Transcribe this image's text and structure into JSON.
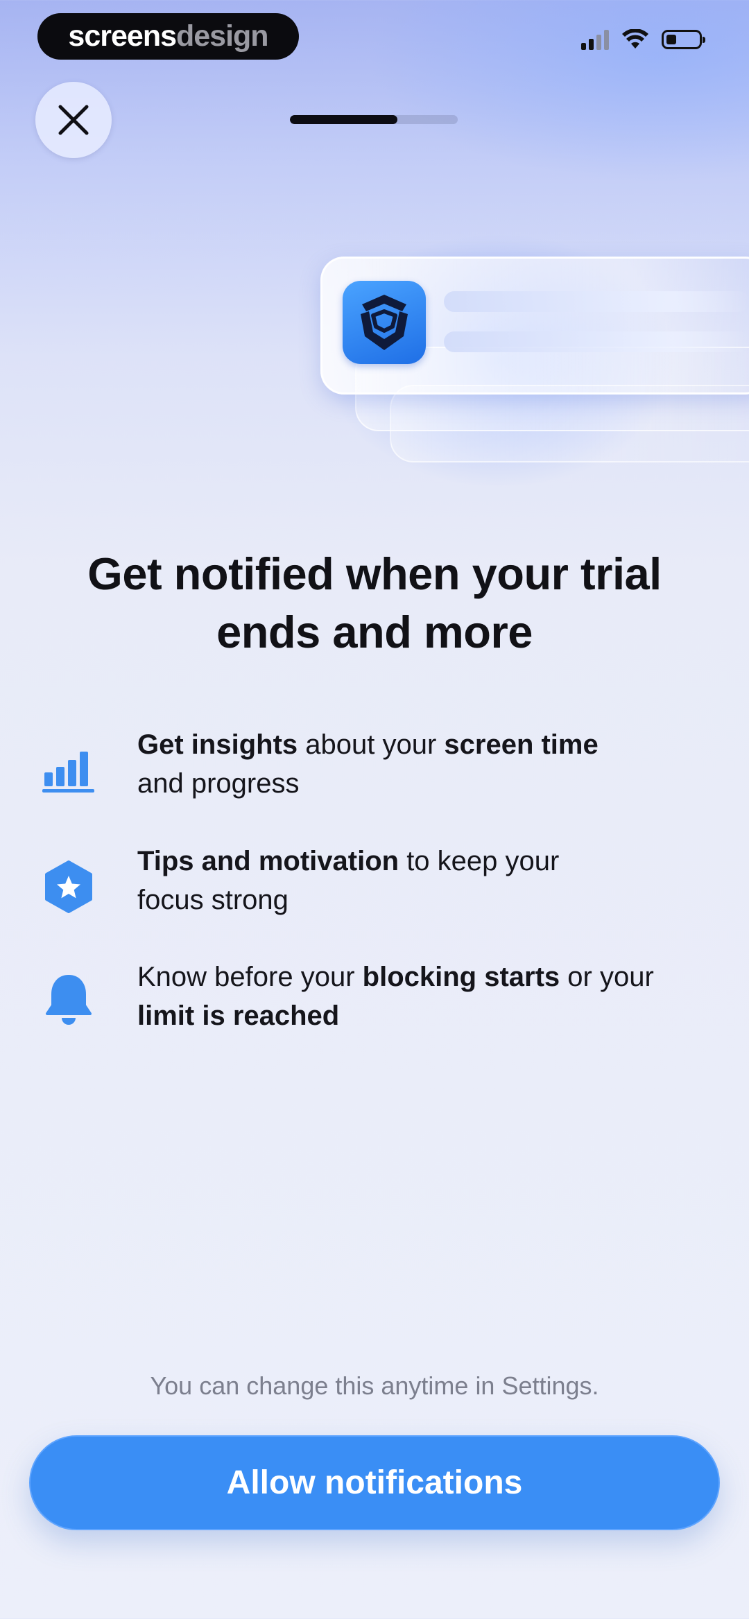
{
  "status_bar": {
    "brand_part1": "screens",
    "brand_part2": "design"
  },
  "onboarding": {
    "progress_fraction": 0.64
  },
  "headline": {
    "line1": "Get notified when your trial",
    "line2": "ends and more"
  },
  "features": [
    {
      "icon": "bar-chart-icon",
      "bold1": "Get insights",
      "text1": " about your ",
      "bold2": "screen time",
      "line2": "and progress"
    },
    {
      "icon": "star-badge-icon",
      "bold1": "Tips and motivation",
      "text1": " to keep your",
      "line2": "focus strong"
    },
    {
      "icon": "bell-icon",
      "text1": "Know before your ",
      "bold1": "blocking starts",
      "text2": " or your",
      "bold2": "limit is reached"
    }
  ],
  "footnote": "You can change this anytime in Settings.",
  "cta_label": "Allow notifications",
  "colors": {
    "accent": "#3a8ef5",
    "icon_blue": "#3d8ef0"
  }
}
